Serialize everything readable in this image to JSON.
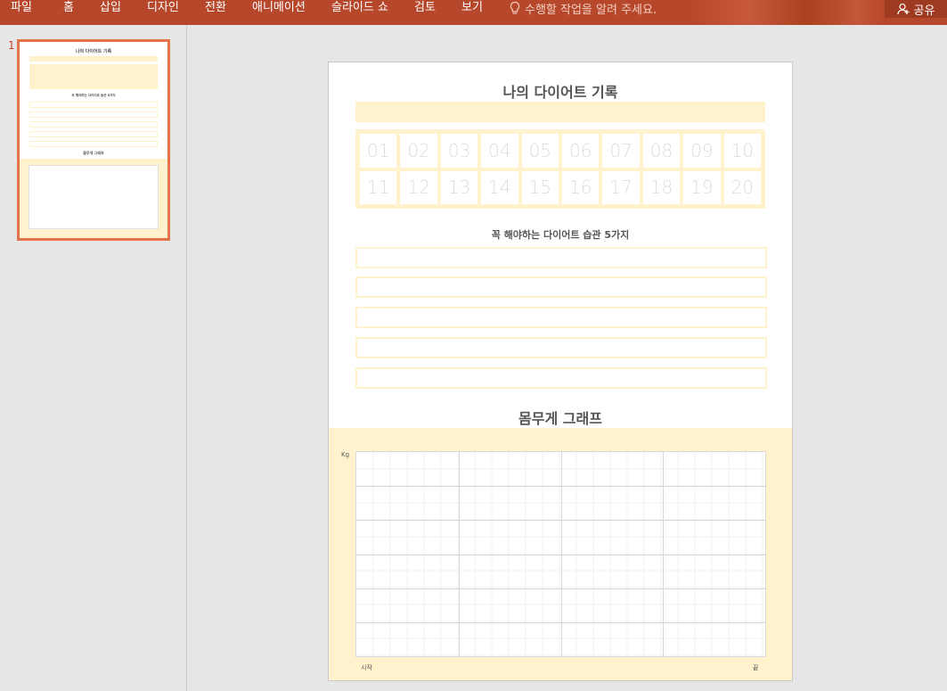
{
  "ribbon": {
    "menu": [
      "파일",
      "홈",
      "삽입",
      "디자인",
      "전환",
      "애니메이션",
      "슬라이드 쇼",
      "검토",
      "보기"
    ],
    "tell_me": "수행할 작업을 알려 주세요.",
    "share": "공유",
    "colors": {
      "ribbon_bg": "#b7472a",
      "accent": "#e2734b"
    }
  },
  "thumbnails": {
    "slide_number": "1"
  },
  "slide": {
    "title": "나의 다이어트 기록",
    "days": [
      "01",
      "02",
      "03",
      "04",
      "05",
      "06",
      "07",
      "08",
      "09",
      "10",
      "11",
      "12",
      "13",
      "14",
      "15",
      "16",
      "17",
      "18",
      "19",
      "20"
    ],
    "habits_title": "꼭 해야하는 다이어트 습관 5가지",
    "habits": [
      "",
      "",
      "",
      "",
      ""
    ],
    "graph_title": "몸무게 그래프",
    "graph_y_unit": "Kg",
    "graph_start_label": "시작",
    "graph_end_label": "끝",
    "colors": {
      "highlight": "#fff2cc",
      "title_text": "#555555"
    }
  }
}
